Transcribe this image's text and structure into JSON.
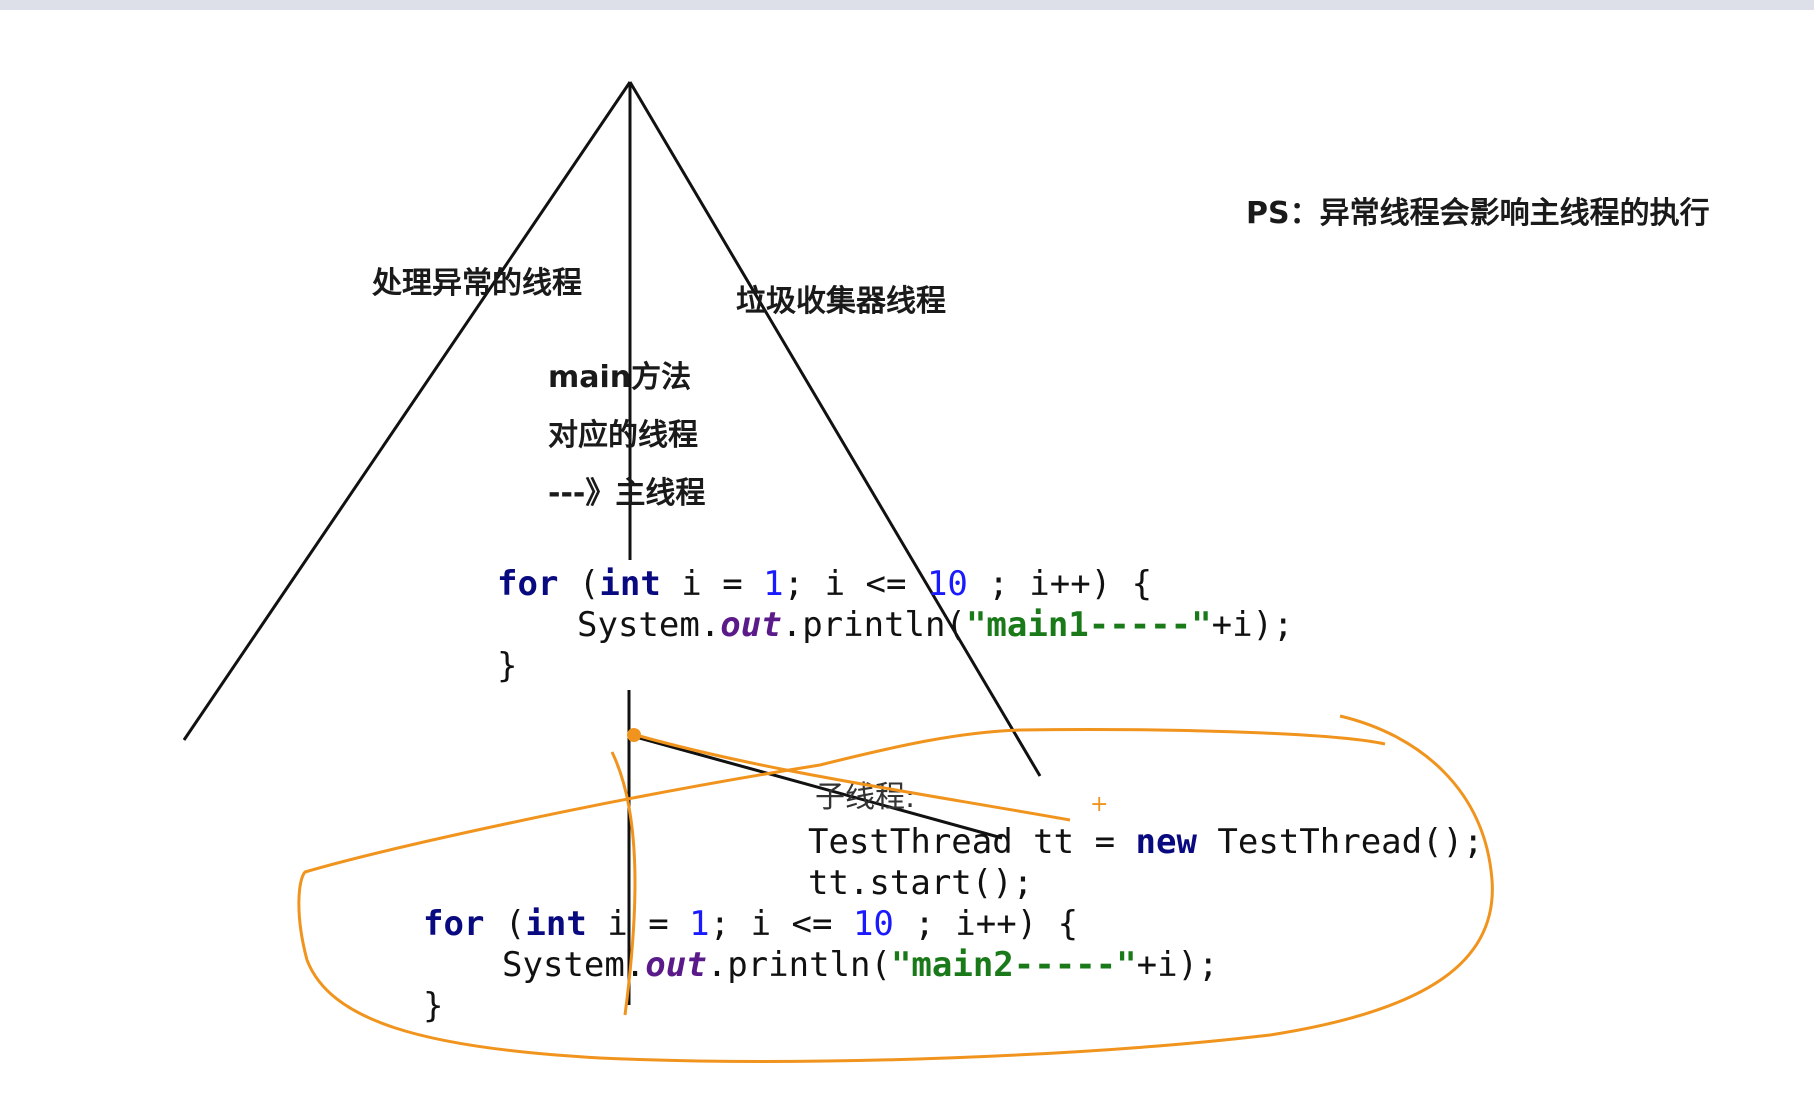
{
  "labels": {
    "ps_note": "PS：异常线程会影响主线程的执行",
    "exception_thread": "处理异常的线程",
    "gc_thread": "垃圾收集器线程",
    "main_line1": "main方法",
    "main_line2": "对应的线程",
    "main_line3": "---》主线程",
    "sub_thread": "子线程:"
  },
  "code1": {
    "for_kw": "for",
    "open": " (",
    "int_kw": "int",
    "mid1": " i = ",
    "n1": "1",
    "mid2": "; i <= ",
    "n10": "10",
    "tail": " ; i++) {",
    "sys": "System.",
    "out": "out",
    "println": ".println(",
    "str": "\"main1-----\"",
    "end": "+i);",
    "close": "}"
  },
  "code2": {
    "decl_a": "TestThread tt = ",
    "new_kw": "new",
    "decl_b": " TestThread();",
    "start": "tt.start();"
  },
  "code3": {
    "for_kw": "for",
    "open": " (",
    "int_kw": "int",
    "mid1": " i = ",
    "n1": "1",
    "mid2": "; i <= ",
    "n10": "10",
    "tail": " ; i++) {",
    "sys": "System.",
    "out": "out",
    "println": ".println(",
    "str": "\"main2-----\"",
    "end": "+i);",
    "close": "}"
  },
  "colors": {
    "ink": "#111111",
    "annotation": "#f0941e"
  }
}
